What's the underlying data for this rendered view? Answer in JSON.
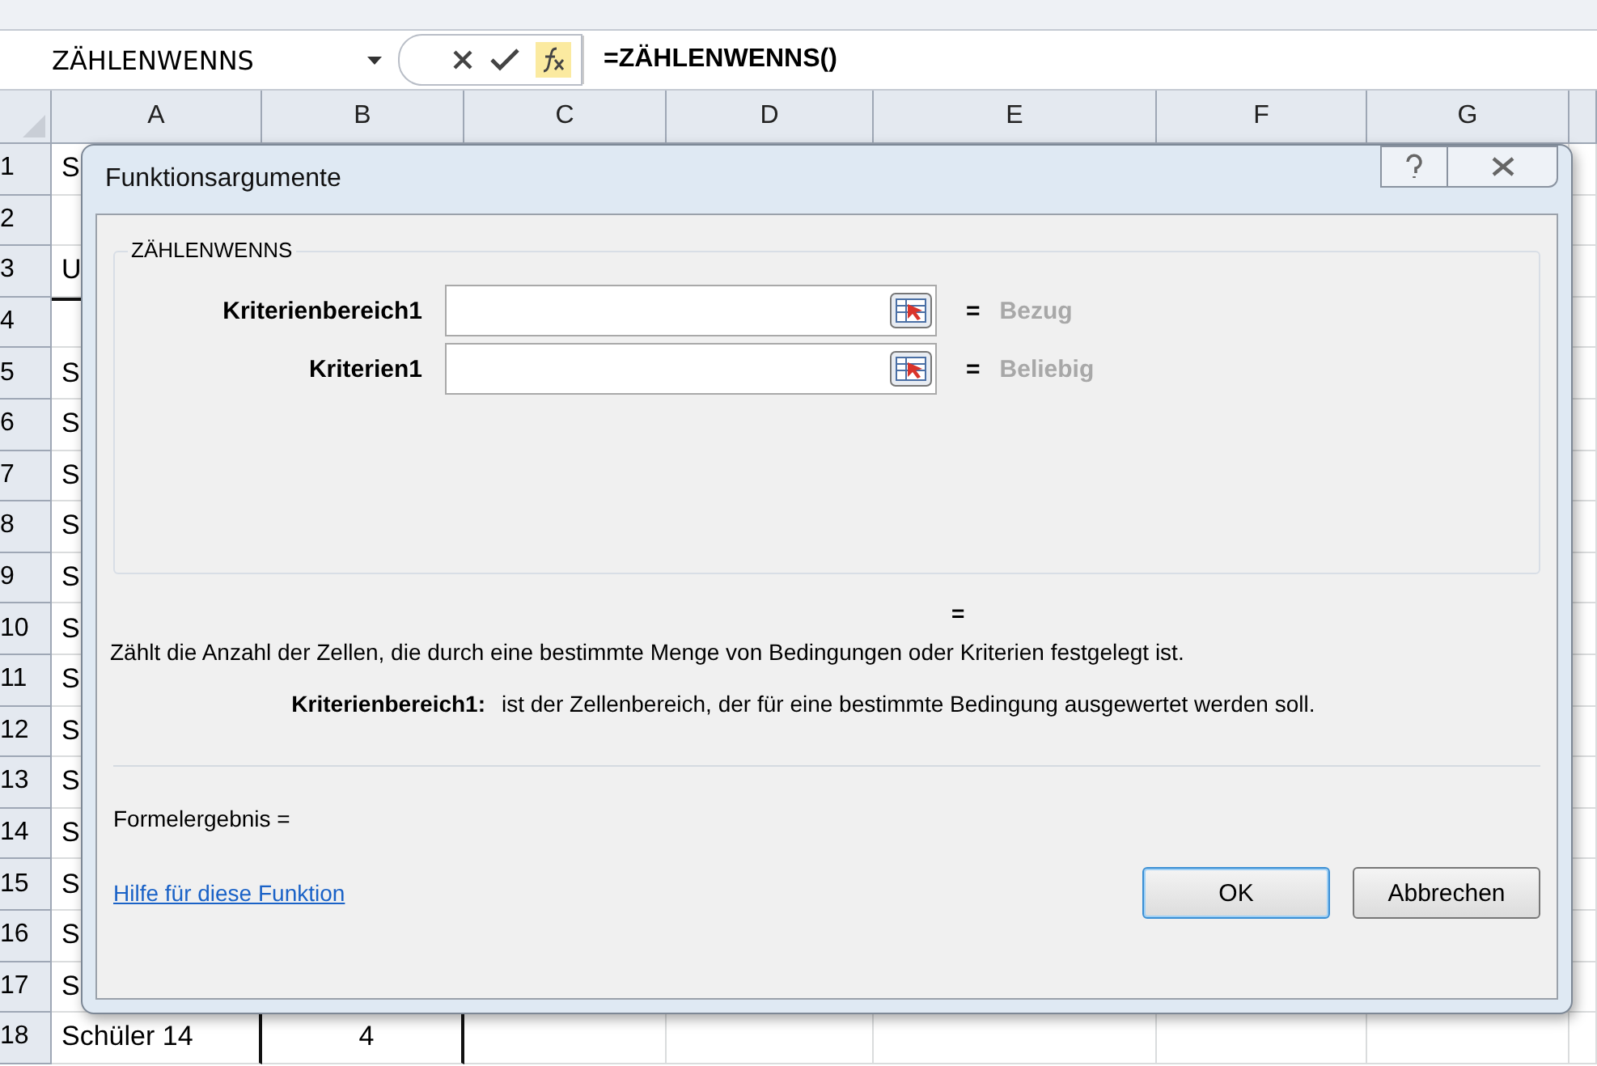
{
  "formula_bar": {
    "name_box": "ZÄHLENWENNS",
    "formula": "=ZÄHLENWENNS()"
  },
  "columns": [
    "A",
    "B",
    "C",
    "D",
    "E",
    "F",
    "G"
  ],
  "rows": [
    {
      "number": "1",
      "cells": [
        "S",
        ""
      ]
    },
    {
      "number": "2",
      "cells": [
        "",
        ""
      ]
    },
    {
      "number": "3",
      "cells": [
        "U",
        ""
      ]
    },
    {
      "number": "4",
      "cells": [
        "",
        ""
      ]
    },
    {
      "number": "5",
      "cells": [
        "S",
        ""
      ]
    },
    {
      "number": "6",
      "cells": [
        "S",
        ""
      ]
    },
    {
      "number": "7",
      "cells": [
        "S",
        ""
      ]
    },
    {
      "number": "8",
      "cells": [
        "S",
        ""
      ]
    },
    {
      "number": "9",
      "cells": [
        "S",
        ""
      ]
    },
    {
      "number": "10",
      "cells": [
        "S",
        ""
      ]
    },
    {
      "number": "11",
      "cells": [
        "S",
        ""
      ]
    },
    {
      "number": "12",
      "cells": [
        "S",
        ""
      ]
    },
    {
      "number": "13",
      "cells": [
        "S",
        ""
      ]
    },
    {
      "number": "14",
      "cells": [
        "S",
        ""
      ]
    },
    {
      "number": "15",
      "cells": [
        "S",
        ""
      ]
    },
    {
      "number": "16",
      "cells": [
        "S",
        ""
      ]
    },
    {
      "number": "17",
      "cells": [
        "S",
        ""
      ]
    },
    {
      "number": "18",
      "cells": [
        "Schüler 14",
        "4"
      ]
    }
  ],
  "dialog": {
    "title": "Funktionsargumente",
    "group_title": "ZÄHLENWENNS",
    "arguments": [
      {
        "label": "Kriterienbereich1",
        "hint": "Bezug",
        "equals": "="
      },
      {
        "label": "Kriterien1",
        "hint": "Beliebig",
        "equals": "="
      }
    ],
    "result_equals": "=",
    "description": "Zählt die Anzahl der Zellen, die durch eine bestimmte Menge von Bedingungen oder Kriterien festgelegt ist.",
    "arg_help": {
      "label": "Kriterienbereich1:",
      "text": "ist der Zellenbereich, der für eine bestimmte Bedingung ausgewertet werden soll."
    },
    "formula_result": "Formelergebnis =",
    "help_link": "Hilfe für diese Funktion",
    "buttons": [
      "OK",
      "Abbrechen"
    ]
  }
}
